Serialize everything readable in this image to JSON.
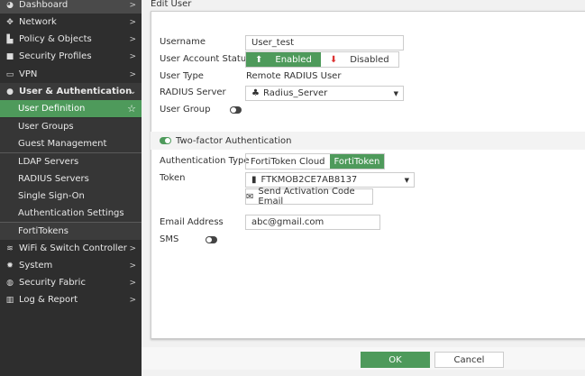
{
  "sidebar": {
    "items": [
      {
        "label": "Dashboard",
        "icon": "dashboard-icon",
        "chevron": ">"
      },
      {
        "label": "Network",
        "icon": "network-icon",
        "chevron": ">"
      },
      {
        "label": "Policy & Objects",
        "icon": "policy-icon",
        "chevron": ">"
      },
      {
        "label": "Security Profiles",
        "icon": "lock-icon",
        "chevron": ">"
      },
      {
        "label": "VPN",
        "icon": "monitor-icon",
        "chevron": ">"
      },
      {
        "label": "User & Authentication",
        "icon": "user-icon",
        "chevron": "⌄"
      },
      {
        "label": "User Definition",
        "star": "☆"
      },
      {
        "label": "User Groups"
      },
      {
        "label": "Guest Management"
      },
      {
        "label": "LDAP Servers"
      },
      {
        "label": "RADIUS Servers"
      },
      {
        "label": "Single Sign-On"
      },
      {
        "label": "Authentication Settings"
      },
      {
        "label": "FortiTokens"
      },
      {
        "label": "WiFi & Switch Controller",
        "icon": "wifi-icon",
        "chevron": ">"
      },
      {
        "label": "System",
        "icon": "gear-icon",
        "chevron": ">"
      },
      {
        "label": "Security Fabric",
        "icon": "fabric-icon",
        "chevron": ">"
      },
      {
        "label": "Log & Report",
        "icon": "chart-icon",
        "chevron": ">"
      }
    ]
  },
  "page": {
    "title": "Edit User"
  },
  "form": {
    "username_label": "Username",
    "username_value": "User_test",
    "status_label": "User Account Status",
    "enabled": "Enabled",
    "disabled": "Disabled",
    "type_label": "User Type",
    "type_value": "Remote RADIUS User",
    "radius_label": "RADIUS Server",
    "radius_value": "Radius_Server",
    "group_label": "User Group",
    "twofactor_label": "Two-factor Authentication",
    "authtype_label": "Authentication Type",
    "authtype_cloud": "FortiToken Cloud",
    "authtype_token": "FortiToken",
    "token_label": "Token",
    "token_value": "FTKMOB2CE7AB8137",
    "send_email": "Send Activation Code Email",
    "email_label": "Email Address",
    "email_value": "abc@gmail.com",
    "sms_label": "SMS"
  },
  "footer": {
    "ok": "OK",
    "cancel": "Cancel"
  },
  "colors": {
    "accent": "#4e9a5b",
    "sidebar": "#2e2e2e"
  }
}
